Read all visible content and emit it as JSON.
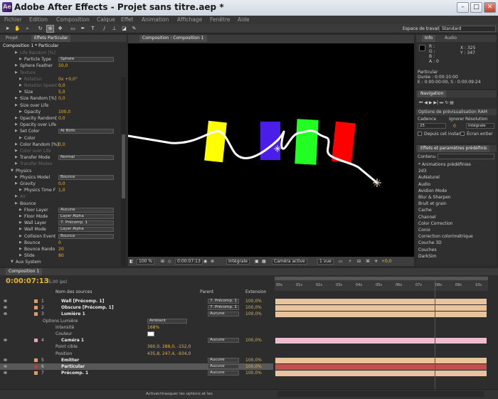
{
  "window": {
    "title": "Adobe After Effects - Projet sans titre.aep *",
    "icon_text": "Ae",
    "min": "–",
    "max": "□",
    "close": "✕"
  },
  "menu": [
    "Fichier",
    "Edition",
    "Composition",
    "Calque",
    "Effet",
    "Animation",
    "Affichage",
    "Fenêtre",
    "Aide"
  ],
  "workspace": {
    "label": "Espace de travail :",
    "value": "Standard"
  },
  "effects_panel": {
    "tabs": [
      "Projet",
      "Effets Particular"
    ],
    "comp_line": "Composition 1 * Particular",
    "rows": [
      {
        "label": "Life Random [%]",
        "value": "",
        "indent": 1,
        "dim": true
      },
      {
        "label": "Particle Type",
        "select": "Sphere",
        "indent": 2
      },
      {
        "label": "Sphere Feather",
        "value": "50,0",
        "indent": 1
      },
      {
        "label": "Texture",
        "value": "",
        "indent": 1,
        "dim": true
      },
      {
        "label": "Rotation",
        "value": "0x +0,0°",
        "indent": 2,
        "dim": true
      },
      {
        "label": "Rotation Speed",
        "value": "0,0",
        "indent": 2,
        "dim": true
      },
      {
        "label": "Size",
        "value": "5,0",
        "indent": 2
      },
      {
        "label": "Size Random [%]",
        "value": "0,0",
        "indent": 1
      },
      {
        "label": "Size over Life",
        "value": "",
        "indent": 1
      },
      {
        "label": "Opacity",
        "value": "100,0",
        "indent": 2
      },
      {
        "label": "Opacity Random[",
        "value": "0,0",
        "indent": 1
      },
      {
        "label": "Opacity over Life",
        "value": "",
        "indent": 1
      },
      {
        "label": "Set Color",
        "select": "At Birth",
        "indent": 1
      },
      {
        "label": "Color",
        "value": "",
        "indent": 2
      },
      {
        "label": "Color Random [%]",
        "value": "0,0",
        "indent": 1
      },
      {
        "label": "Color over Life",
        "value": "",
        "indent": 1,
        "dim": true
      },
      {
        "label": "Transfer Mode",
        "select": "Normal",
        "indent": 1
      },
      {
        "label": "Transfer Modes",
        "value": "",
        "indent": 1,
        "dim": true
      },
      {
        "label": "Physics",
        "value": "",
        "indent": 0
      },
      {
        "label": "Physics Model",
        "select": "Bounce",
        "indent": 1
      },
      {
        "label": "Gravity",
        "value": "0,0",
        "indent": 1
      },
      {
        "label": "Physics Time F",
        "value": "1,0",
        "indent": 2
      },
      {
        "label": "Air",
        "value": "",
        "indent": 1,
        "dim": true
      },
      {
        "label": "Bounce",
        "value": "",
        "indent": 1
      },
      {
        "label": "Floor Layer",
        "select": "Aucune",
        "indent": 2
      },
      {
        "label": "Floor Mode",
        "select": "Layer Alpha",
        "indent": 2
      },
      {
        "label": "Wall Layer",
        "select": "7. Précomp. 1",
        "indent": 2
      },
      {
        "label": "Wall Mode",
        "select": "Layer Alpha",
        "indent": 2
      },
      {
        "label": "Collision Event",
        "select": "Bounce",
        "indent": 2
      },
      {
        "label": "Bounce",
        "value": "0",
        "indent": 2
      },
      {
        "label": "Bounce Rando",
        "value": "20",
        "indent": 2
      },
      {
        "label": "Slide",
        "value": "80",
        "indent": 2
      },
      {
        "label": "Aux System",
        "value": "",
        "indent": 0
      }
    ]
  },
  "comp_panel": {
    "tab": "Composition : Composition 1",
    "footer": {
      "zoom": "100 %",
      "timecode": "0:00:07:13",
      "resolution": "Intégrale",
      "camera": "Caméra active",
      "view": "1 vue",
      "exposure": "+0,0"
    },
    "colors": {
      "yellow": "#ffff00",
      "blue": "#4a1ee8",
      "green": "#22ff22",
      "red": "#ff0000"
    }
  },
  "info": {
    "tabs": [
      "Info",
      "Audio"
    ],
    "r": "R :",
    "g": "G :",
    "b": "B :",
    "a": "A : 0",
    "x": "X : 325",
    "y": "Y : 347",
    "layer": "Particular",
    "duration": "Durée : 0:00:10:00",
    "range": "E : 0:00:00:00, S : 0:00:09:24"
  },
  "navigation": {
    "tab": "Navigation"
  },
  "preview": {
    "header": "Options de prévisualisation RAM",
    "cadence_label": "Cadence",
    "ignore_label": "Ignorer",
    "resolution_label": "Résolution",
    "cadence": "25",
    "ignore": "0",
    "resolution": "Intégrale",
    "from_current": "Depuis cet instant",
    "fullscreen": "Écran entier"
  },
  "effects_presets": {
    "tab": "Effets et paramètres prédéfinis",
    "search_label": "Contenu :",
    "items": [
      "* Animations prédéfinies",
      "2d3",
      "AuNaturel",
      "Audio",
      "Avidion Mode",
      "Blur & Sharpen",
      "Bruit et grain",
      "Cache",
      "Channel",
      "Color Correction",
      "Conix",
      "Correction colorimétrique",
      "Couche 3D",
      "Couches",
      "DarkSim"
    ]
  },
  "timeline": {
    "tab": "Composition 1",
    "timecode": "0:00:07:13",
    "fps": "(25,00 ips)",
    "col_source": "Nom des sources",
    "col_parent": "Parent",
    "col_ext": "Extension",
    "ruler": [
      "00s",
      "01s",
      "02s",
      "03s",
      "04s",
      "05s",
      "06s",
      "07s",
      "08s",
      "09s",
      "10s"
    ],
    "layers": [
      {
        "num": "1",
        "name": "Wall [Précomp. 1]",
        "parent": "7. Précomp. 1",
        "ext": "100,0%",
        "label": "#d8a070",
        "bar": "#e8c49c"
      },
      {
        "num": "2",
        "name": "Obscure [Précomp. 1]",
        "parent": "7. Précomp. 1",
        "ext": "100,0%",
        "label": "#d8a070",
        "bar": "#e8c49c"
      },
      {
        "num": "3",
        "name": "Lumière 1",
        "parent": "Aucune",
        "ext": "100,0%",
        "label": "#d8a070",
        "bar": "#e8c49c"
      },
      {
        "sub": "Options Lumière",
        "select": "Ambiant"
      },
      {
        "prop": "Intensité",
        "pval": "168%"
      },
      {
        "prop": "Couleur",
        "pval": ""
      },
      {
        "num": "4",
        "name": "Caméra 1",
        "parent": "Aucune",
        "ext": "100,0%",
        "label": "#e4a4c0",
        "bar": "#f0bcd0"
      },
      {
        "prop": "Point cible",
        "pval": "360,0, 288,0, -152,0"
      },
      {
        "prop": "Position",
        "pval": "435,8, 247,4, -934,0"
      },
      {
        "num": "5",
        "name": "Emitter",
        "parent": "Aucune",
        "ext": "100,0%",
        "label": "#d8a070",
        "bar": "#e8c49c"
      },
      {
        "num": "6",
        "name": "Particular",
        "parent": "Aucune",
        "ext": "100,0%",
        "label": "#b04040",
        "bar": "#c05050"
      },
      {
        "num": "7",
        "name": "Précomp. 1",
        "parent": "Aucune",
        "ext": "100,0%",
        "label": "#d8a070",
        "bar": "#e8c49c"
      }
    ],
    "footer": "Activer/masquer les options et les"
  }
}
